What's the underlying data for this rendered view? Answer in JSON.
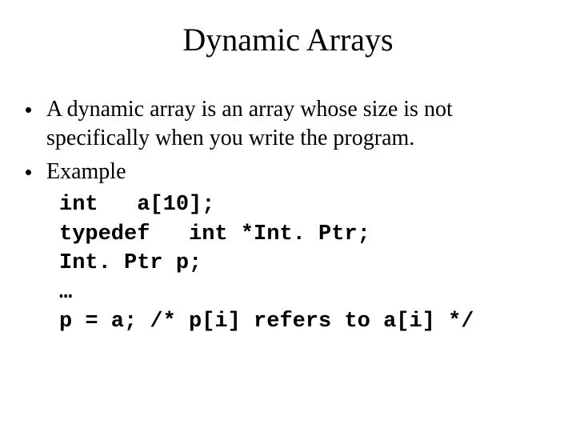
{
  "title": "Dynamic Arrays",
  "bullets": [
    "A dynamic array is an array whose size is not specifically when you write the program.",
    "Example"
  ],
  "code": "int   a[10];\ntypedef   int *Int. Ptr;\nInt. Ptr p;\n…\np = a; /* p[i] refers to a[i] */"
}
